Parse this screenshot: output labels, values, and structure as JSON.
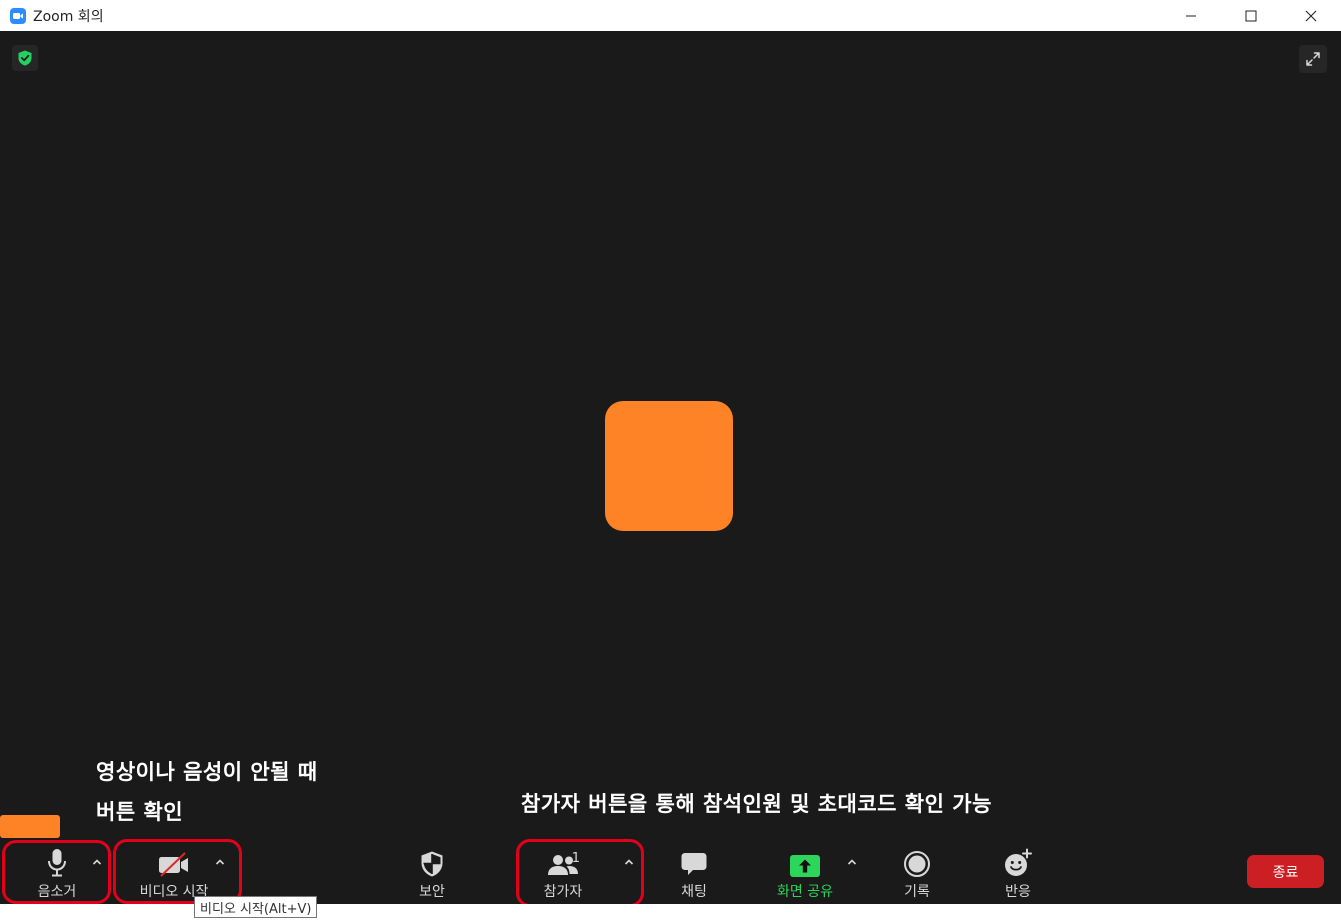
{
  "window": {
    "title": "Zoom 회의"
  },
  "annotations": {
    "left_line1": "영상이나 음성이 안될 때",
    "left_line2": "버튼 확인",
    "right": "참가자 버튼을 통해 참석인원 및 초대코드 확인 가능"
  },
  "toolbar": {
    "mute_label": "음소거",
    "video_label": "비디오 시작",
    "security_label": "보안",
    "participants_label": "참가자",
    "participants_count": "1",
    "chat_label": "채팅",
    "share_label": "화면 공유",
    "record_label": "기록",
    "reactions_label": "반응",
    "end_label": "종료"
  },
  "tooltip": {
    "text": "비디오 시작(Alt+V)"
  },
  "colors": {
    "accent_orange": "#fe8326",
    "highlight_red": "#e3001b",
    "share_green": "#2bd65b",
    "end_red": "#cc1f24",
    "zoom_blue": "#2d8cff"
  }
}
